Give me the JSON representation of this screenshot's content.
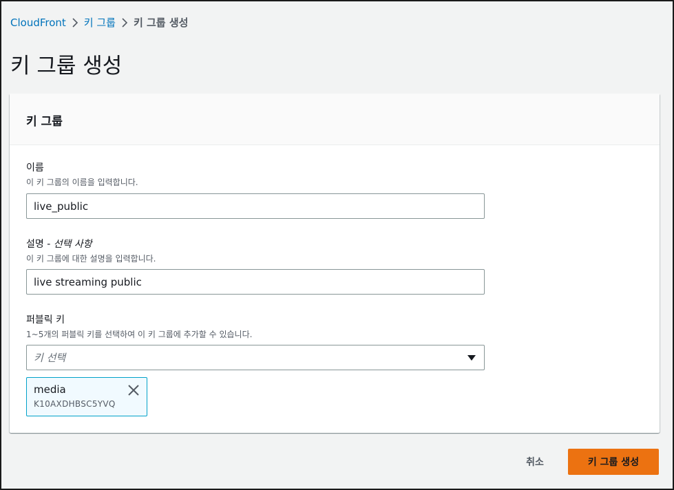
{
  "breadcrumb": {
    "items": [
      "CloudFront",
      "키 그룹",
      "키 그룹 생성"
    ],
    "separator_icon": "chevron-right-icon"
  },
  "page_title": "키 그룹 생성",
  "panel": {
    "title": "키 그룹"
  },
  "form": {
    "name": {
      "label": "이름",
      "description": "이 키 그룹의 이름을 입력합니다.",
      "value": "live_public"
    },
    "description": {
      "label": "설명 - ",
      "label_optional": "선택 사항",
      "description": "이 키 그룹에 대한 설명을 입력합니다.",
      "value": "live streaming public"
    },
    "public_keys": {
      "label": "퍼블릭 키",
      "description": "1~5개의 퍼블릭 키를 선택하여 이 키 그룹에 추가할 수 있습니다.",
      "placeholder": "키 선택",
      "caret_icon": "caret-down-icon",
      "selected": [
        {
          "name": "media",
          "id": "K10AXDHBSC5YVQ",
          "remove_icon": "close-icon"
        }
      ]
    }
  },
  "actions": {
    "cancel_label": "취소",
    "submit_label": "키 그룹 생성"
  },
  "colors": {
    "link": "#0073bb",
    "primary_button": "#ec7211",
    "token_background": "#f1faff",
    "token_border": "#00a1c9"
  }
}
